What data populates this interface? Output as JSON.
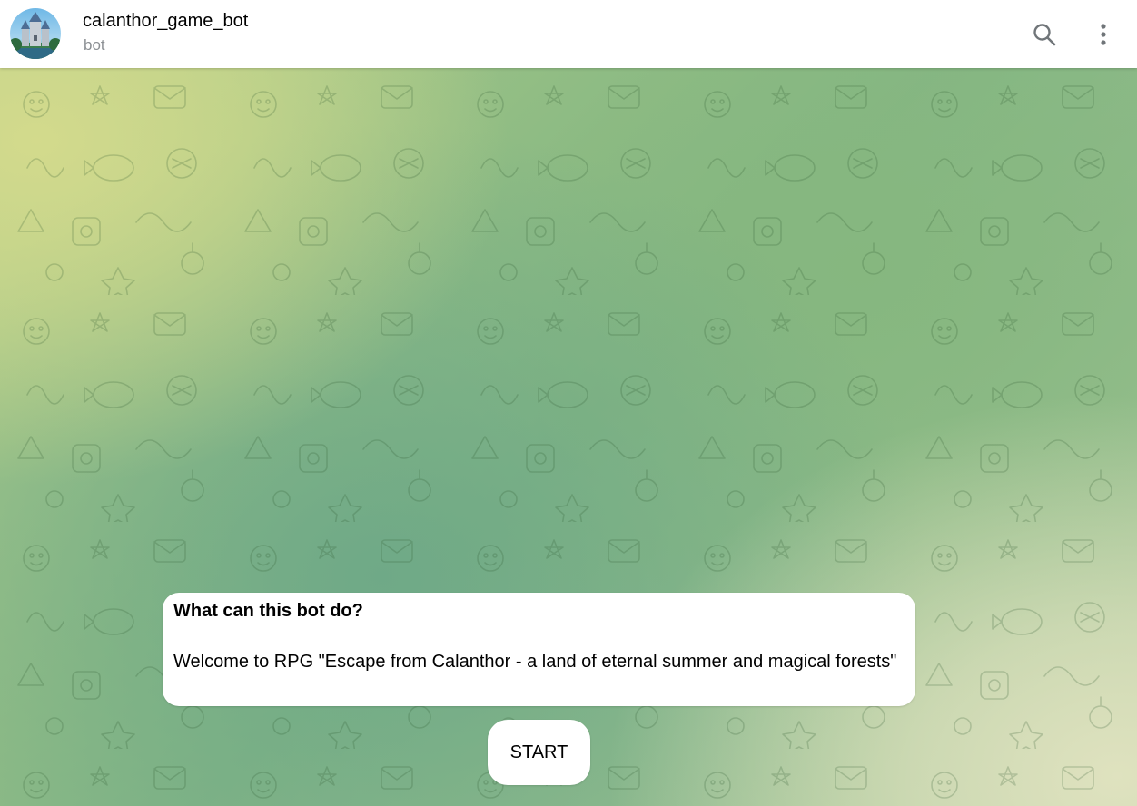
{
  "header": {
    "title": "calanthor_game_bot",
    "subtitle": "bot",
    "avatar_icon": "castle-avatar-icon",
    "search_icon": "search-icon",
    "menu_icon": "more-vertical-icon"
  },
  "bot_info": {
    "heading": "What can this bot do?",
    "description": "Welcome to RPG \"Escape from Calanthor - a land of eternal summer and magical forests\""
  },
  "start_button": {
    "label": "START"
  },
  "colors": {
    "header_bg": "#ffffff",
    "chat_bg_green": "#84b685",
    "chat_bg_yellow": "#d3da8c",
    "bubble_bg": "#ffffff",
    "icon_gray": "#707579"
  }
}
